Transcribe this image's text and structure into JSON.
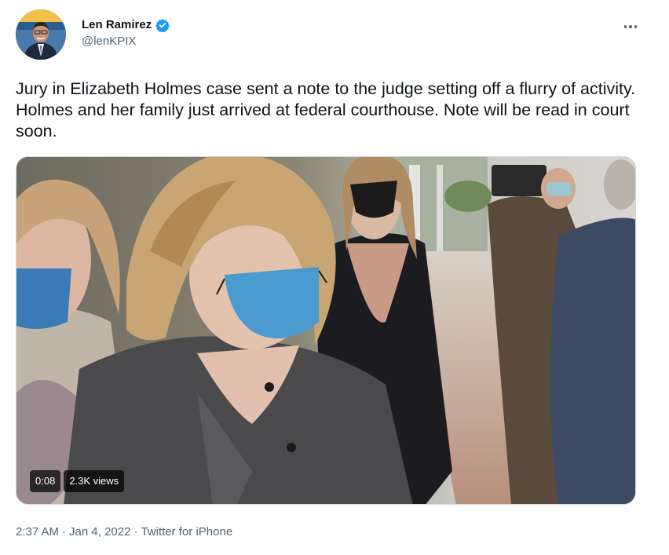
{
  "author": {
    "name": "Len Ramirez",
    "handle": "@lenKPIX",
    "verified": true,
    "avatar_icon": "profile-photo",
    "accent": "#1d9bf0"
  },
  "more_icon": "ellipsis-icon",
  "tweet": {
    "text": "Jury in Elizabeth Holmes case sent a note to the judge setting off a flurry of activity.   Holmes and her family just arrived at federal courthouse. Note will be read in court soon."
  },
  "video": {
    "duration": "0:08",
    "views": "2.3K views"
  },
  "meta": {
    "time": "2:37 AM",
    "separator": "·",
    "date": "Jan 4, 2022",
    "source": "Twitter for iPhone"
  }
}
